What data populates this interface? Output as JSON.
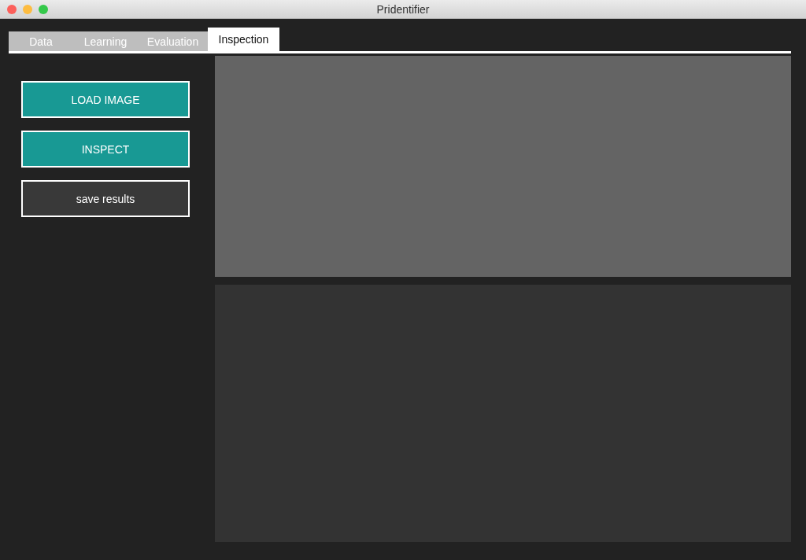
{
  "window": {
    "title": "Pridentifier"
  },
  "tabs": [
    {
      "label": "Data",
      "selected": false
    },
    {
      "label": "Learning",
      "selected": false
    },
    {
      "label": "Evaluation",
      "selected": false
    },
    {
      "label": "Inspection",
      "selected": true
    }
  ],
  "buttons": [
    {
      "label": "LOAD IMAGE",
      "kind": "accent"
    },
    {
      "label": "INSPECT",
      "kind": "accent"
    },
    {
      "label": "save results",
      "kind": "plain"
    }
  ]
}
